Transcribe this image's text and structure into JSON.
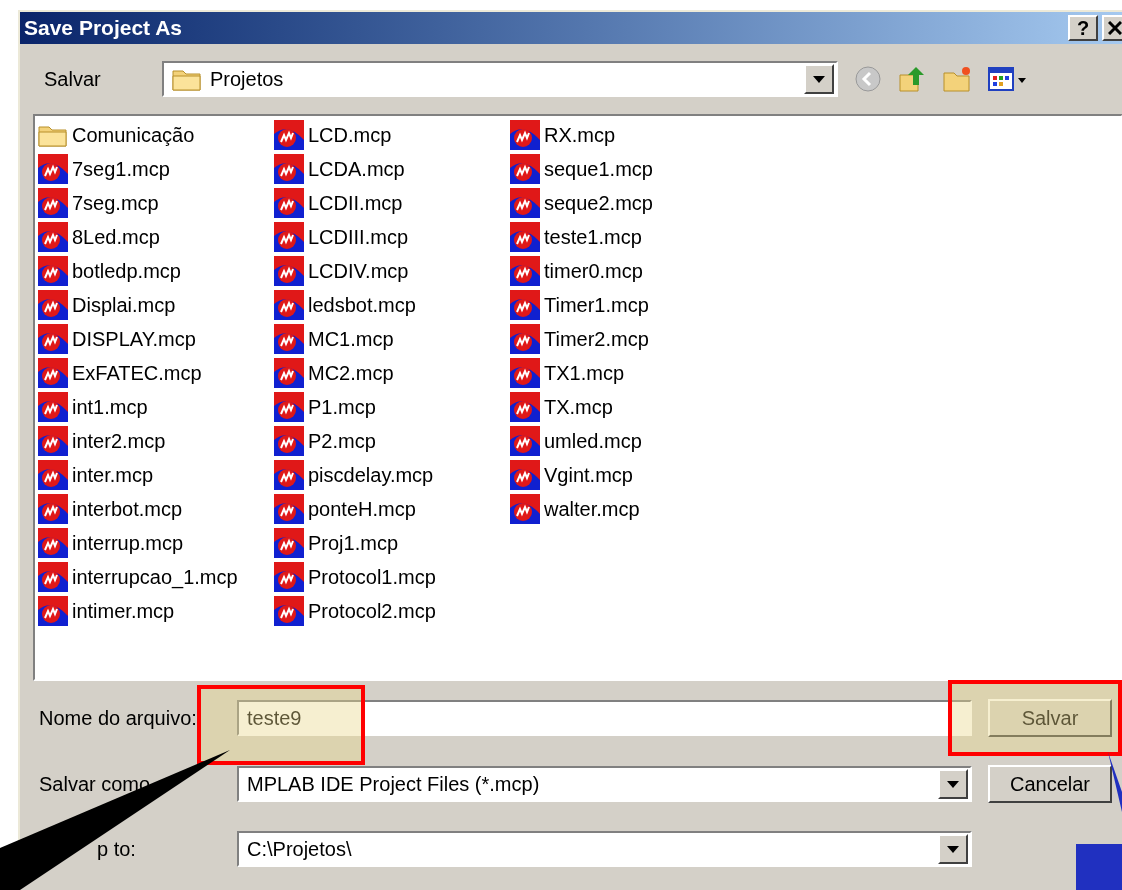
{
  "window": {
    "title": "Save Project As",
    "help_button": "?"
  },
  "save_in": {
    "label": "Salvar",
    "value": "Projetos"
  },
  "files": [
    {
      "name": "Comunicação",
      "kind": "folder"
    },
    {
      "name": "7seg1.mcp",
      "kind": "project"
    },
    {
      "name": "7seg.mcp",
      "kind": "project"
    },
    {
      "name": "8Led.mcp",
      "kind": "project"
    },
    {
      "name": "botledp.mcp",
      "kind": "project"
    },
    {
      "name": "Displai.mcp",
      "kind": "project"
    },
    {
      "name": "DISPLAY.mcp",
      "kind": "project"
    },
    {
      "name": "ExFATEC.mcp",
      "kind": "project"
    },
    {
      "name": "int1.mcp",
      "kind": "project"
    },
    {
      "name": "inter2.mcp",
      "kind": "project"
    },
    {
      "name": "inter.mcp",
      "kind": "project"
    },
    {
      "name": "interbot.mcp",
      "kind": "project"
    },
    {
      "name": "interrup.mcp",
      "kind": "project"
    },
    {
      "name": "interrupcao_1.mcp",
      "kind": "project"
    },
    {
      "name": "intimer.mcp",
      "kind": "project"
    },
    {
      "name": "LCD.mcp",
      "kind": "project"
    },
    {
      "name": "LCDA.mcp",
      "kind": "project"
    },
    {
      "name": "LCDII.mcp",
      "kind": "project"
    },
    {
      "name": "LCDIII.mcp",
      "kind": "project"
    },
    {
      "name": "LCDIV.mcp",
      "kind": "project"
    },
    {
      "name": "ledsbot.mcp",
      "kind": "project"
    },
    {
      "name": "MC1.mcp",
      "kind": "project"
    },
    {
      "name": "MC2.mcp",
      "kind": "project"
    },
    {
      "name": "P1.mcp",
      "kind": "project"
    },
    {
      "name": "P2.mcp",
      "kind": "project"
    },
    {
      "name": "piscdelay.mcp",
      "kind": "project"
    },
    {
      "name": "ponteH.mcp",
      "kind": "project"
    },
    {
      "name": "Proj1.mcp",
      "kind": "project"
    },
    {
      "name": "Protocol1.mcp",
      "kind": "project"
    },
    {
      "name": "Protocol2.mcp",
      "kind": "project"
    },
    {
      "name": "RX.mcp",
      "kind": "project"
    },
    {
      "name": "seque1.mcp",
      "kind": "project"
    },
    {
      "name": "seque2.mcp",
      "kind": "project"
    },
    {
      "name": "teste1.mcp",
      "kind": "project"
    },
    {
      "name": "timer0.mcp",
      "kind": "project"
    },
    {
      "name": "Timer1.mcp",
      "kind": "project"
    },
    {
      "name": "Timer2.mcp",
      "kind": "project"
    },
    {
      "name": "TX1.mcp",
      "kind": "project"
    },
    {
      "name": "TX.mcp",
      "kind": "project"
    },
    {
      "name": "umled.mcp",
      "kind": "project"
    },
    {
      "name": "Vgint.mcp",
      "kind": "project"
    },
    {
      "name": "walter.mcp",
      "kind": "project"
    }
  ],
  "file_name": {
    "label": "Nome do arquivo:",
    "value": "teste9"
  },
  "save_as_type": {
    "label": "Salvar como",
    "value": "MPLAB IDE Project Files (*.mcp)"
  },
  "jump_to": {
    "label": "p to:",
    "value": "C:\\Projetos\\"
  },
  "buttons": [
    "Salvar",
    "Cancelar"
  ]
}
